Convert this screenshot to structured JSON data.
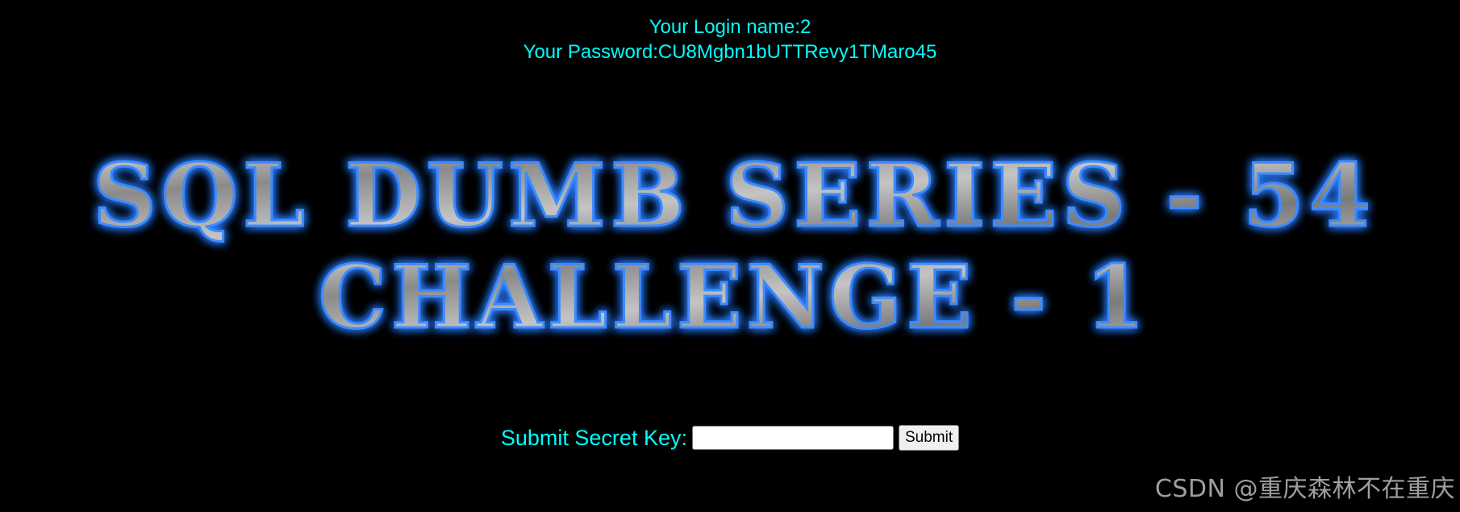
{
  "credentials": {
    "login_label": "Your Login name:",
    "login_value": "2",
    "password_label": "Your Password:",
    "password_value": "CU8Mgbn1bUTTRevy1TMaro45"
  },
  "banner": {
    "line1": "SQL DUMB SERIES - 54",
    "line2": "CHALLENGE - 1",
    "text_color": "#8c8c8c",
    "glow_color": "#2a7bff"
  },
  "form": {
    "label": "Submit Secret Key:",
    "input_value": "",
    "submit_label": "Submit"
  },
  "watermark": {
    "text": "CSDN @重庆森林不在重庆"
  },
  "colors": {
    "background": "#000000",
    "text_cyan": "#00ffff"
  }
}
